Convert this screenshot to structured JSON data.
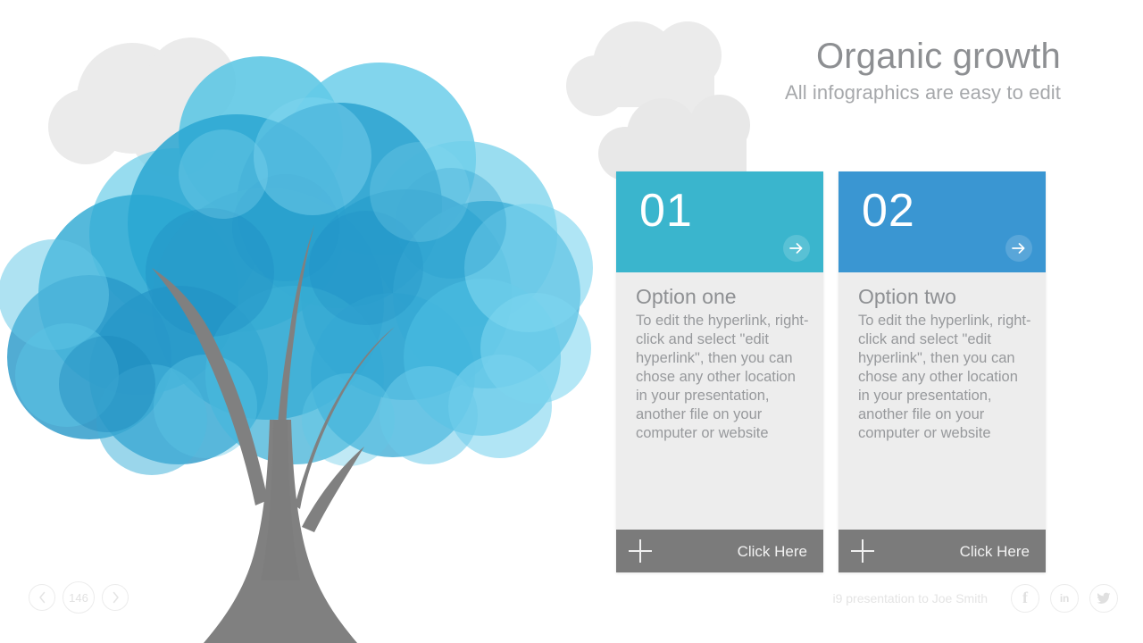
{
  "header": {
    "title": "Organic growth",
    "subtitle": "All infographics are easy to edit"
  },
  "cards": [
    {
      "number": "01",
      "title": "Option one",
      "body": "To edit the hyperlink, right-click and select \"edit hyperlink\", then you can chose any other location in your presentation, another file on your computer or website",
      "cta": "Click Here",
      "header_color": "#3ab5cd",
      "footer_color": "#7b7b7b",
      "arrow_icon": "arrow-right-icon",
      "plus_icon": "plus-icon"
    },
    {
      "number": "02",
      "title": "Option two",
      "body": "To edit the hyperlink, right-click and select \"edit hyperlink\", then you can chose any other location in your presentation, another file on your computer or website",
      "cta": "Click Here",
      "header_color": "#3a96d2",
      "footer_color": "#7b7b7b",
      "arrow_icon": "arrow-right-icon",
      "plus_icon": "plus-icon"
    }
  ],
  "pager": {
    "prev_icon": "chevron-left-icon",
    "next_icon": "chevron-right-icon",
    "page_number": "146"
  },
  "footer": {
    "note": "i9 presentation to Joe Smith",
    "social": [
      {
        "name": "facebook-icon",
        "glyph": "f"
      },
      {
        "name": "linkedin-icon",
        "glyph": "in"
      },
      {
        "name": "twitter-icon",
        "glyph": "bird"
      }
    ]
  },
  "illustration": {
    "name": "organic-growth-tree",
    "trunk_color": "#808080",
    "foliage_colors": [
      "#4fc0dc",
      "#2fa8d3",
      "#2b9cd0",
      "#5cc8e8",
      "#7fd3ec",
      "#1f8fc4"
    ],
    "cloud_color": "#ebebeb"
  },
  "canvas": {
    "background": "#ffffff"
  }
}
